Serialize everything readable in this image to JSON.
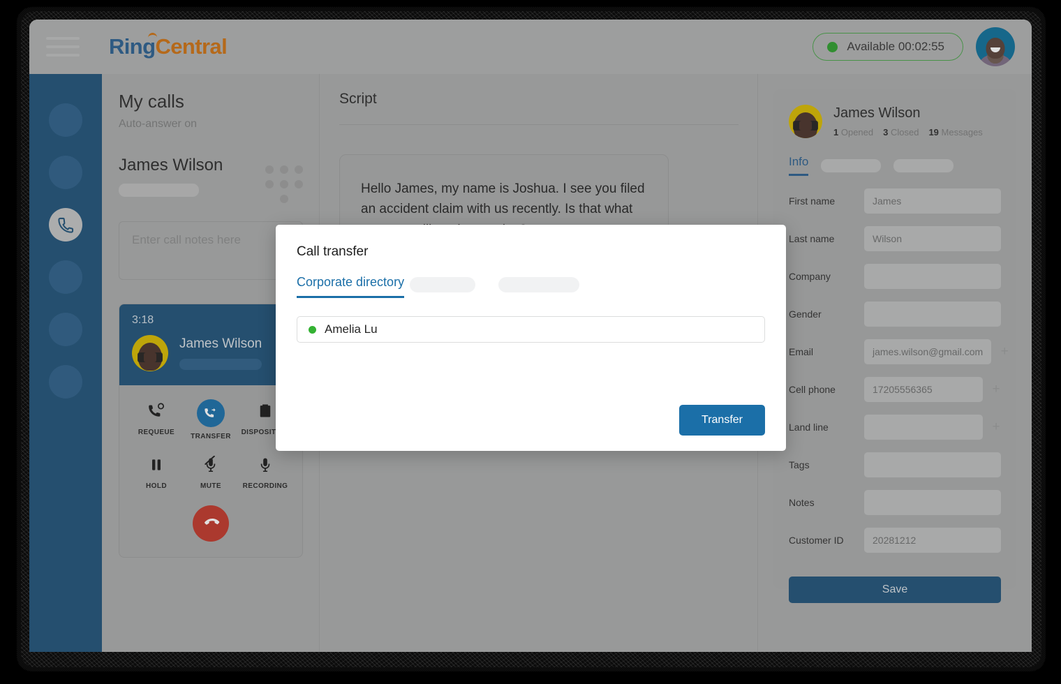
{
  "topbar": {
    "menu_icon": "hamburger-icon",
    "logo_part1": "Ring",
    "logo_part2": "Central",
    "status_text": "Available 00:02:55",
    "status_color": "#2f9e2f",
    "avatar_icon": "agent-avatar"
  },
  "rail": {
    "items": [
      {
        "name": "nav-placeholder-1",
        "icon": ""
      },
      {
        "name": "nav-placeholder-2",
        "icon": ""
      },
      {
        "name": "nav-calls",
        "icon": "phone-icon",
        "active": true
      },
      {
        "name": "nav-placeholder-4",
        "icon": ""
      },
      {
        "name": "nav-placeholder-5",
        "icon": ""
      },
      {
        "name": "nav-placeholder-6",
        "icon": ""
      }
    ]
  },
  "calls": {
    "title": "My calls",
    "subtitle": "Auto-answer on",
    "contact_name": "James Wilson",
    "dialpad_icon": "dialpad-icon",
    "notes_placeholder": "Enter call notes here",
    "card": {
      "timer": "3:18",
      "person_name": "James Wilson",
      "controls": [
        {
          "label": "REQUEUE",
          "icon": "requeue-icon",
          "active": false
        },
        {
          "label": "TRANSFER",
          "icon": "transfer-icon",
          "active": true
        },
        {
          "label": "DISPOSITION",
          "icon": "clipboard-icon",
          "active": false
        },
        {
          "label": "HOLD",
          "icon": "pause-icon",
          "active": false
        },
        {
          "label": "MUTE",
          "icon": "mic-muted-icon",
          "active": false
        },
        {
          "label": "RECORDING",
          "icon": "mic-icon",
          "active": false
        }
      ],
      "hangup_icon": "hangup-icon"
    }
  },
  "script": {
    "title": "Script",
    "text": "Hello James, my name is Joshua. I see you filed an accident claim with us recently. Is that what you are calling about today?"
  },
  "contact": {
    "name": "James Wilson",
    "stats": [
      {
        "count": "1",
        "label": "Opened"
      },
      {
        "count": "3",
        "label": "Closed"
      },
      {
        "count": "19",
        "label": "Messages"
      }
    ],
    "tabs": [
      {
        "label": "Info",
        "active": true
      },
      {
        "label": "",
        "active": false
      },
      {
        "label": "",
        "active": false
      }
    ],
    "fields": [
      {
        "label": "First name",
        "value": "James",
        "plus": false
      },
      {
        "label": "Last name",
        "value": "Wilson",
        "plus": false
      },
      {
        "label": "Company",
        "value": "",
        "plus": false
      },
      {
        "label": "Gender",
        "value": "",
        "plus": false
      },
      {
        "label": "Email",
        "value": "james.wilson@gmail.com",
        "plus": true
      },
      {
        "label": "Cell phone",
        "value": "17205556365",
        "plus": true
      },
      {
        "label": "Land line",
        "value": "",
        "plus": true
      },
      {
        "label": "Tags",
        "value": "",
        "plus": false
      },
      {
        "label": "Notes",
        "value": "",
        "plus": false
      },
      {
        "label": "Customer ID",
        "value": "20281212",
        "plus": false
      }
    ],
    "save_label": "Save"
  },
  "modal": {
    "title": "Call transfer",
    "tabs": [
      {
        "label": "Corporate directory",
        "active": true
      },
      {
        "label": "",
        "active": false
      },
      {
        "label": "",
        "active": false
      }
    ],
    "directory": [
      {
        "name": "Amelia Lu",
        "status": "online",
        "status_color": "#34b233"
      }
    ],
    "transfer_label": "Transfer"
  }
}
